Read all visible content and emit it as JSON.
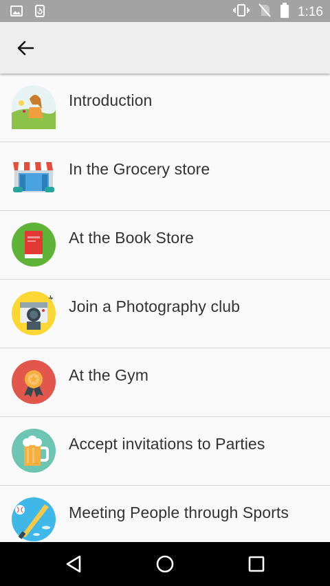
{
  "status_bar": {
    "time": "1:16",
    "left_icons": [
      "image-icon",
      "sync-icon"
    ],
    "right_icons": [
      "vibrate-icon",
      "no-sim-icon",
      "battery-icon"
    ]
  },
  "app_bar": {
    "back_icon": "arrow-back-icon"
  },
  "topics": [
    {
      "label": "Introduction",
      "icon": "girl-in-meadow-icon"
    },
    {
      "label": "In the Grocery store",
      "icon": "storefront-icon"
    },
    {
      "label": "At the Book Store",
      "icon": "book-icon"
    },
    {
      "label": "Join a Photography club",
      "icon": "camera-icon"
    },
    {
      "label": "At the Gym",
      "icon": "medal-icon"
    },
    {
      "label": "Accept invitations to Parties",
      "icon": "beer-mug-icon"
    },
    {
      "label": "Meeting People through Sports",
      "icon": "baseball-bat-icon"
    }
  ],
  "nav_bar": {
    "buttons": [
      "back-triangle-icon",
      "home-circle-icon",
      "recents-square-icon"
    ]
  },
  "colors": {
    "status_bar": "#a3a3a3",
    "app_bar": "#eeeeee",
    "background": "#fafafa",
    "divider": "#d6d6d6",
    "text": "#333333",
    "nav_bar": "#000000"
  }
}
